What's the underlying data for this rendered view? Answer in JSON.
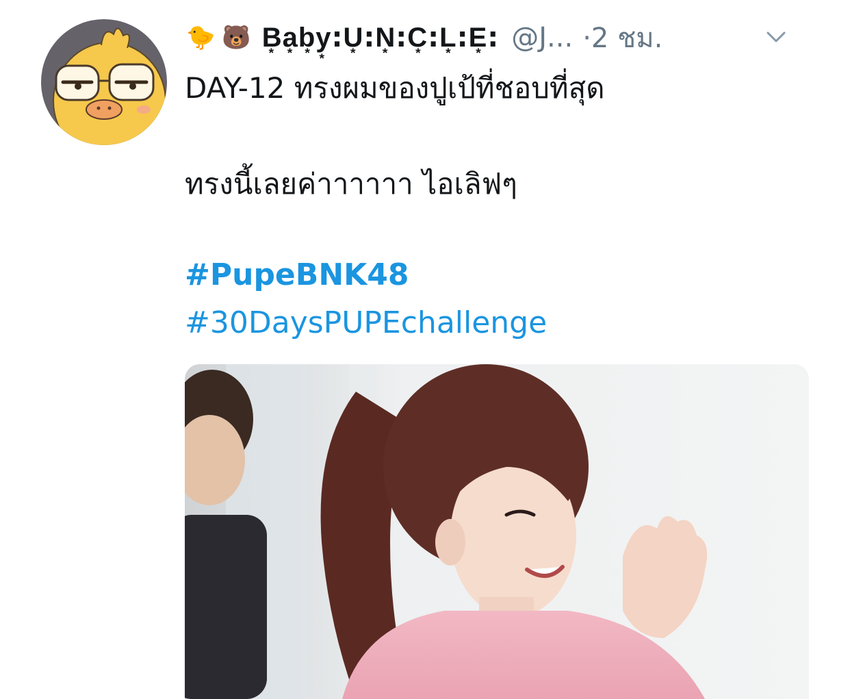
{
  "tweet": {
    "emoji_1": "🐤",
    "emoji_2": "🐻",
    "display_name": "B͙a͙b͙y͙:U͙:N͙:C͙:L͙:E͙:",
    "handle": "@J...",
    "time": "·2 ชม.",
    "text_line_1": "DAY-12 ทรงผมของปูเป้ที่ชอบที่สุด",
    "text_line_2": "ทรงนี้เลยค่าาาาาา ไอเลิฟๆ",
    "hashtags": [
      "#PupeBNK48",
      "#30DaysPUPEchallenge"
    ]
  },
  "icons": {
    "menu": "chevron-down-icon",
    "avatar": "cartoon-chick-avatar"
  },
  "colors": {
    "link": "#1b95e0",
    "secondary_text": "#657786",
    "primary_text": "#14171a",
    "avatar_bg": "#66626a",
    "avatar_face": "#f6c84c"
  }
}
